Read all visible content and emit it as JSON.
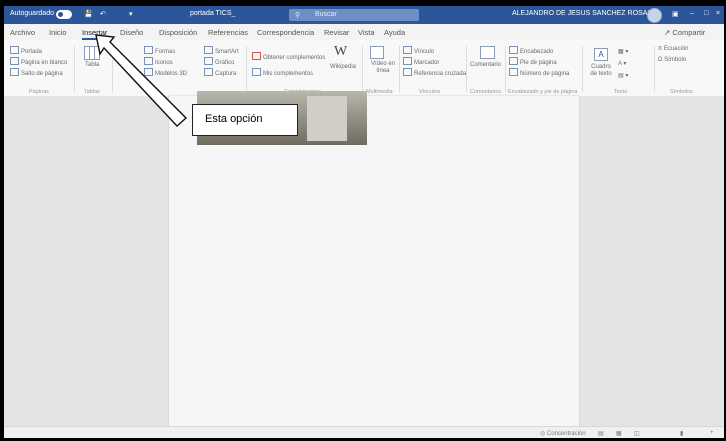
{
  "titlebar": {
    "autosave": "Autoguardado",
    "filename": "portada TICS_",
    "search": "Buscar",
    "user": "ALEJANDRO DE JESUS SANCHEZ ROSAS"
  },
  "menu": {
    "items": [
      "Archivo",
      "Inicio",
      "Insertar",
      "Diseño",
      "Disposición",
      "Referencias",
      "Correspondencia",
      "Revisar",
      "Vista",
      "Ayuda"
    ],
    "share": "Compartir"
  },
  "ribbon": {
    "paginas": [
      "Portada",
      "Página en blanco",
      "Salto de página"
    ],
    "paginas_label": "Páginas",
    "tabla": "Tabla",
    "tablas_label": "Tablas",
    "ilustraciones": [
      "Formas",
      "Iconos",
      "Modelos 3D"
    ],
    "smartart": [
      "SmartArt",
      "Gráfico",
      "Captura"
    ],
    "ilustraciones_label": "Ilustraciones",
    "complementos": [
      "Obtener complementos",
      "Mis complementos"
    ],
    "wikipedia": "Wikipedia",
    "complementos_label": "Complementos",
    "video": "Vídeo en línea",
    "multimedia_label": "Multimedia",
    "vinculos": [
      "Vínculo",
      "Marcador",
      "Referencia cruzada"
    ],
    "vinculos_label": "Vínculos",
    "comentario": "Comentario",
    "comentarios_label": "Comentarios",
    "encabezado": [
      "Encabezado",
      "Pie de página",
      "Número de página"
    ],
    "encabezado_label": "Encabezado y pie de página",
    "cuadro_texto": "Cuadro de texto",
    "texto_label": "Texto",
    "simbolos": [
      "Ecuación",
      "Símbolo"
    ],
    "simbolos_label": "Símbolos"
  },
  "callout": {
    "text": "Esta opción"
  },
  "status": {
    "focus": "Concentración"
  }
}
